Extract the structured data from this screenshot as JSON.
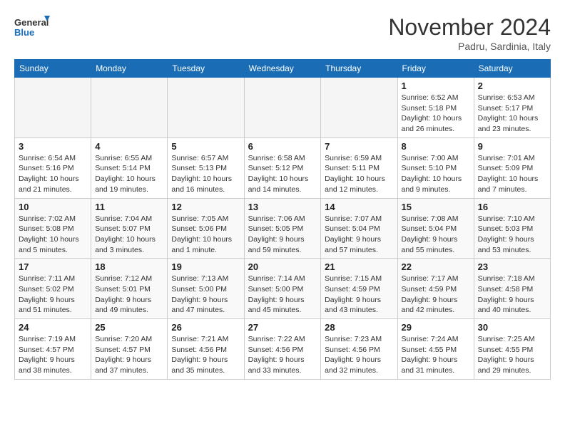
{
  "logo": {
    "line1": "General",
    "line2": "Blue"
  },
  "title": "November 2024",
  "subtitle": "Padru, Sardinia, Italy",
  "days_of_week": [
    "Sunday",
    "Monday",
    "Tuesday",
    "Wednesday",
    "Thursday",
    "Friday",
    "Saturday"
  ],
  "weeks": [
    [
      {
        "day": "",
        "info": ""
      },
      {
        "day": "",
        "info": ""
      },
      {
        "day": "",
        "info": ""
      },
      {
        "day": "",
        "info": ""
      },
      {
        "day": "",
        "info": ""
      },
      {
        "day": "1",
        "info": "Sunrise: 6:52 AM\nSunset: 5:18 PM\nDaylight: 10 hours and 26 minutes."
      },
      {
        "day": "2",
        "info": "Sunrise: 6:53 AM\nSunset: 5:17 PM\nDaylight: 10 hours and 23 minutes."
      }
    ],
    [
      {
        "day": "3",
        "info": "Sunrise: 6:54 AM\nSunset: 5:16 PM\nDaylight: 10 hours and 21 minutes."
      },
      {
        "day": "4",
        "info": "Sunrise: 6:55 AM\nSunset: 5:14 PM\nDaylight: 10 hours and 19 minutes."
      },
      {
        "day": "5",
        "info": "Sunrise: 6:57 AM\nSunset: 5:13 PM\nDaylight: 10 hours and 16 minutes."
      },
      {
        "day": "6",
        "info": "Sunrise: 6:58 AM\nSunset: 5:12 PM\nDaylight: 10 hours and 14 minutes."
      },
      {
        "day": "7",
        "info": "Sunrise: 6:59 AM\nSunset: 5:11 PM\nDaylight: 10 hours and 12 minutes."
      },
      {
        "day": "8",
        "info": "Sunrise: 7:00 AM\nSunset: 5:10 PM\nDaylight: 10 hours and 9 minutes."
      },
      {
        "day": "9",
        "info": "Sunrise: 7:01 AM\nSunset: 5:09 PM\nDaylight: 10 hours and 7 minutes."
      }
    ],
    [
      {
        "day": "10",
        "info": "Sunrise: 7:02 AM\nSunset: 5:08 PM\nDaylight: 10 hours and 5 minutes."
      },
      {
        "day": "11",
        "info": "Sunrise: 7:04 AM\nSunset: 5:07 PM\nDaylight: 10 hours and 3 minutes."
      },
      {
        "day": "12",
        "info": "Sunrise: 7:05 AM\nSunset: 5:06 PM\nDaylight: 10 hours and 1 minute."
      },
      {
        "day": "13",
        "info": "Sunrise: 7:06 AM\nSunset: 5:05 PM\nDaylight: 9 hours and 59 minutes."
      },
      {
        "day": "14",
        "info": "Sunrise: 7:07 AM\nSunset: 5:04 PM\nDaylight: 9 hours and 57 minutes."
      },
      {
        "day": "15",
        "info": "Sunrise: 7:08 AM\nSunset: 5:04 PM\nDaylight: 9 hours and 55 minutes."
      },
      {
        "day": "16",
        "info": "Sunrise: 7:10 AM\nSunset: 5:03 PM\nDaylight: 9 hours and 53 minutes."
      }
    ],
    [
      {
        "day": "17",
        "info": "Sunrise: 7:11 AM\nSunset: 5:02 PM\nDaylight: 9 hours and 51 minutes."
      },
      {
        "day": "18",
        "info": "Sunrise: 7:12 AM\nSunset: 5:01 PM\nDaylight: 9 hours and 49 minutes."
      },
      {
        "day": "19",
        "info": "Sunrise: 7:13 AM\nSunset: 5:00 PM\nDaylight: 9 hours and 47 minutes."
      },
      {
        "day": "20",
        "info": "Sunrise: 7:14 AM\nSunset: 5:00 PM\nDaylight: 9 hours and 45 minutes."
      },
      {
        "day": "21",
        "info": "Sunrise: 7:15 AM\nSunset: 4:59 PM\nDaylight: 9 hours and 43 minutes."
      },
      {
        "day": "22",
        "info": "Sunrise: 7:17 AM\nSunset: 4:59 PM\nDaylight: 9 hours and 42 minutes."
      },
      {
        "day": "23",
        "info": "Sunrise: 7:18 AM\nSunset: 4:58 PM\nDaylight: 9 hours and 40 minutes."
      }
    ],
    [
      {
        "day": "24",
        "info": "Sunrise: 7:19 AM\nSunset: 4:57 PM\nDaylight: 9 hours and 38 minutes."
      },
      {
        "day": "25",
        "info": "Sunrise: 7:20 AM\nSunset: 4:57 PM\nDaylight: 9 hours and 37 minutes."
      },
      {
        "day": "26",
        "info": "Sunrise: 7:21 AM\nSunset: 4:56 PM\nDaylight: 9 hours and 35 minutes."
      },
      {
        "day": "27",
        "info": "Sunrise: 7:22 AM\nSunset: 4:56 PM\nDaylight: 9 hours and 33 minutes."
      },
      {
        "day": "28",
        "info": "Sunrise: 7:23 AM\nSunset: 4:56 PM\nDaylight: 9 hours and 32 minutes."
      },
      {
        "day": "29",
        "info": "Sunrise: 7:24 AM\nSunset: 4:55 PM\nDaylight: 9 hours and 31 minutes."
      },
      {
        "day": "30",
        "info": "Sunrise: 7:25 AM\nSunset: 4:55 PM\nDaylight: 9 hours and 29 minutes."
      }
    ]
  ]
}
